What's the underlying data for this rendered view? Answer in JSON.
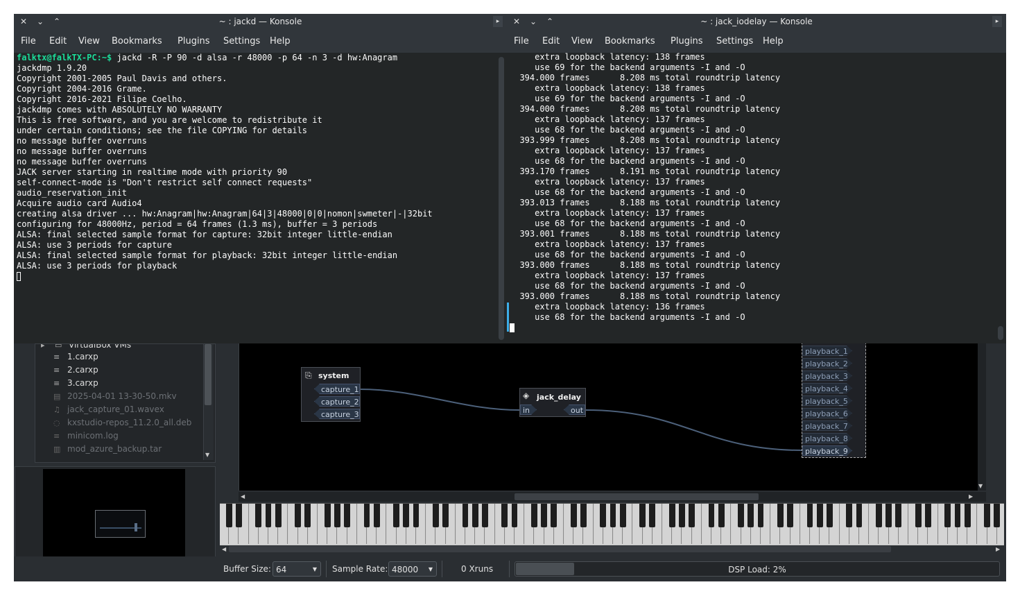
{
  "konsole_left": {
    "title": "~ : jackd — Konsole",
    "menu": [
      "File",
      "Edit",
      "View",
      "Bookmarks",
      "Plugins",
      "Settings",
      "Help"
    ],
    "prompt": "falktx@falkTX-PC:~$",
    "command": " jackd -R -P 90 -d alsa -r 48000 -p 64 -n 3 -d hw:Anagram",
    "lines": [
      "jackdmp 1.9.20",
      "Copyright 2001-2005 Paul Davis and others.",
      "Copyright 2004-2016 Grame.",
      "Copyright 2016-2021 Filipe Coelho.",
      "jackdmp comes with ABSOLUTELY NO WARRANTY",
      "This is free software, and you are welcome to redistribute it",
      "under certain conditions; see the file COPYING for details",
      "no message buffer overruns",
      "no message buffer overruns",
      "no message buffer overruns",
      "JACK server starting in realtime mode with priority 90",
      "self-connect-mode is \"Don't restrict self connect requests\"",
      "audio_reservation_init",
      "Acquire audio card Audio4",
      "creating alsa driver ... hw:Anagram|hw:Anagram|64|3|48000|0|0|nomon|swmeter|-|32bit",
      "configuring for 48000Hz, period = 64 frames (1.3 ms), buffer = 3 periods",
      "ALSA: final selected sample format for capture: 32bit integer little-endian",
      "ALSA: use 3 periods for capture",
      "ALSA: final selected sample format for playback: 32bit integer little-endian",
      "ALSA: use 3 periods for playback"
    ]
  },
  "konsole_right": {
    "title": "~ : jack_iodelay — Konsole",
    "menu": [
      "File",
      "Edit",
      "View",
      "Bookmarks",
      "Plugins",
      "Settings",
      "Help"
    ],
    "lines": [
      "     extra loopback latency: 138 frames",
      "     use 69 for the backend arguments -I and -O",
      "  394.000 frames      8.208 ms total roundtrip latency",
      "     extra loopback latency: 138 frames",
      "     use 69 for the backend arguments -I and -O",
      "  394.000 frames      8.208 ms total roundtrip latency",
      "     extra loopback latency: 137 frames",
      "     use 68 for the backend arguments -I and -O",
      "  393.999 frames      8.208 ms total roundtrip latency",
      "     extra loopback latency: 137 frames",
      "     use 68 for the backend arguments -I and -O",
      "  393.170 frames      8.191 ms total roundtrip latency",
      "     extra loopback latency: 137 frames",
      "     use 68 for the backend arguments -I and -O",
      "  393.013 frames      8.188 ms total roundtrip latency",
      "     extra loopback latency: 137 frames",
      "     use 68 for the backend arguments -I and -O",
      "  393.001 frames      8.188 ms total roundtrip latency",
      "     extra loopback latency: 137 frames",
      "     use 68 for the backend arguments -I and -O",
      "  393.000 frames      8.188 ms total roundtrip latency",
      "     extra loopback latency: 137 frames",
      "     use 68 for the backend arguments -I and -O",
      "  393.000 frames      8.188 ms total roundtrip latency",
      "     extra loopback latency: 136 frames",
      "     use 68 for the backend arguments -I and -O"
    ]
  },
  "file_tree": {
    "folder": "VirtualBox VMs",
    "files": [
      {
        "name": "1.carxp",
        "icon": "text-file-icon",
        "dim": false
      },
      {
        "name": "2.carxp",
        "icon": "text-file-icon",
        "dim": false
      },
      {
        "name": "3.carxp",
        "icon": "text-file-icon",
        "dim": false
      },
      {
        "name": "2025-04-01 13-30-50.mkv",
        "icon": "video-file-icon",
        "dim": true
      },
      {
        "name": "jack_capture_01.wavex",
        "icon": "audio-file-icon",
        "dim": true
      },
      {
        "name": "kxstudio-repos_11.2.0_all.deb",
        "icon": "package-icon",
        "dim": true
      },
      {
        "name": "minicom.log",
        "icon": "text-file-icon",
        "dim": true
      },
      {
        "name": "mod_azure_backup.tar",
        "icon": "archive-icon",
        "dim": true
      }
    ]
  },
  "patchbay": {
    "system": {
      "title": "system",
      "captures": [
        "capture_1",
        "capture_2",
        "capture_3"
      ]
    },
    "jack_delay": {
      "title": "jack_delay",
      "in": "in",
      "out": "out"
    },
    "playbacks": [
      "playback_1",
      "playback_2",
      "playback_3",
      "playback_4",
      "playback_5",
      "playback_6",
      "playback_7",
      "playback_8",
      "playback_9"
    ]
  },
  "statusbar": {
    "buffer_size_label": "Buffer Size:",
    "buffer_size_value": "64",
    "sample_rate_label": "Sample Rate:",
    "sample_rate_value": "48000",
    "xruns": "0 Xruns",
    "dsp_load": "DSP Load: 2%",
    "dsp_load_fraction": 0.02
  },
  "colors": {
    "terminal_bg": "#232627",
    "prompt": "#1cdc9a",
    "titlebar": "#31363b",
    "port": "#2a3646"
  }
}
